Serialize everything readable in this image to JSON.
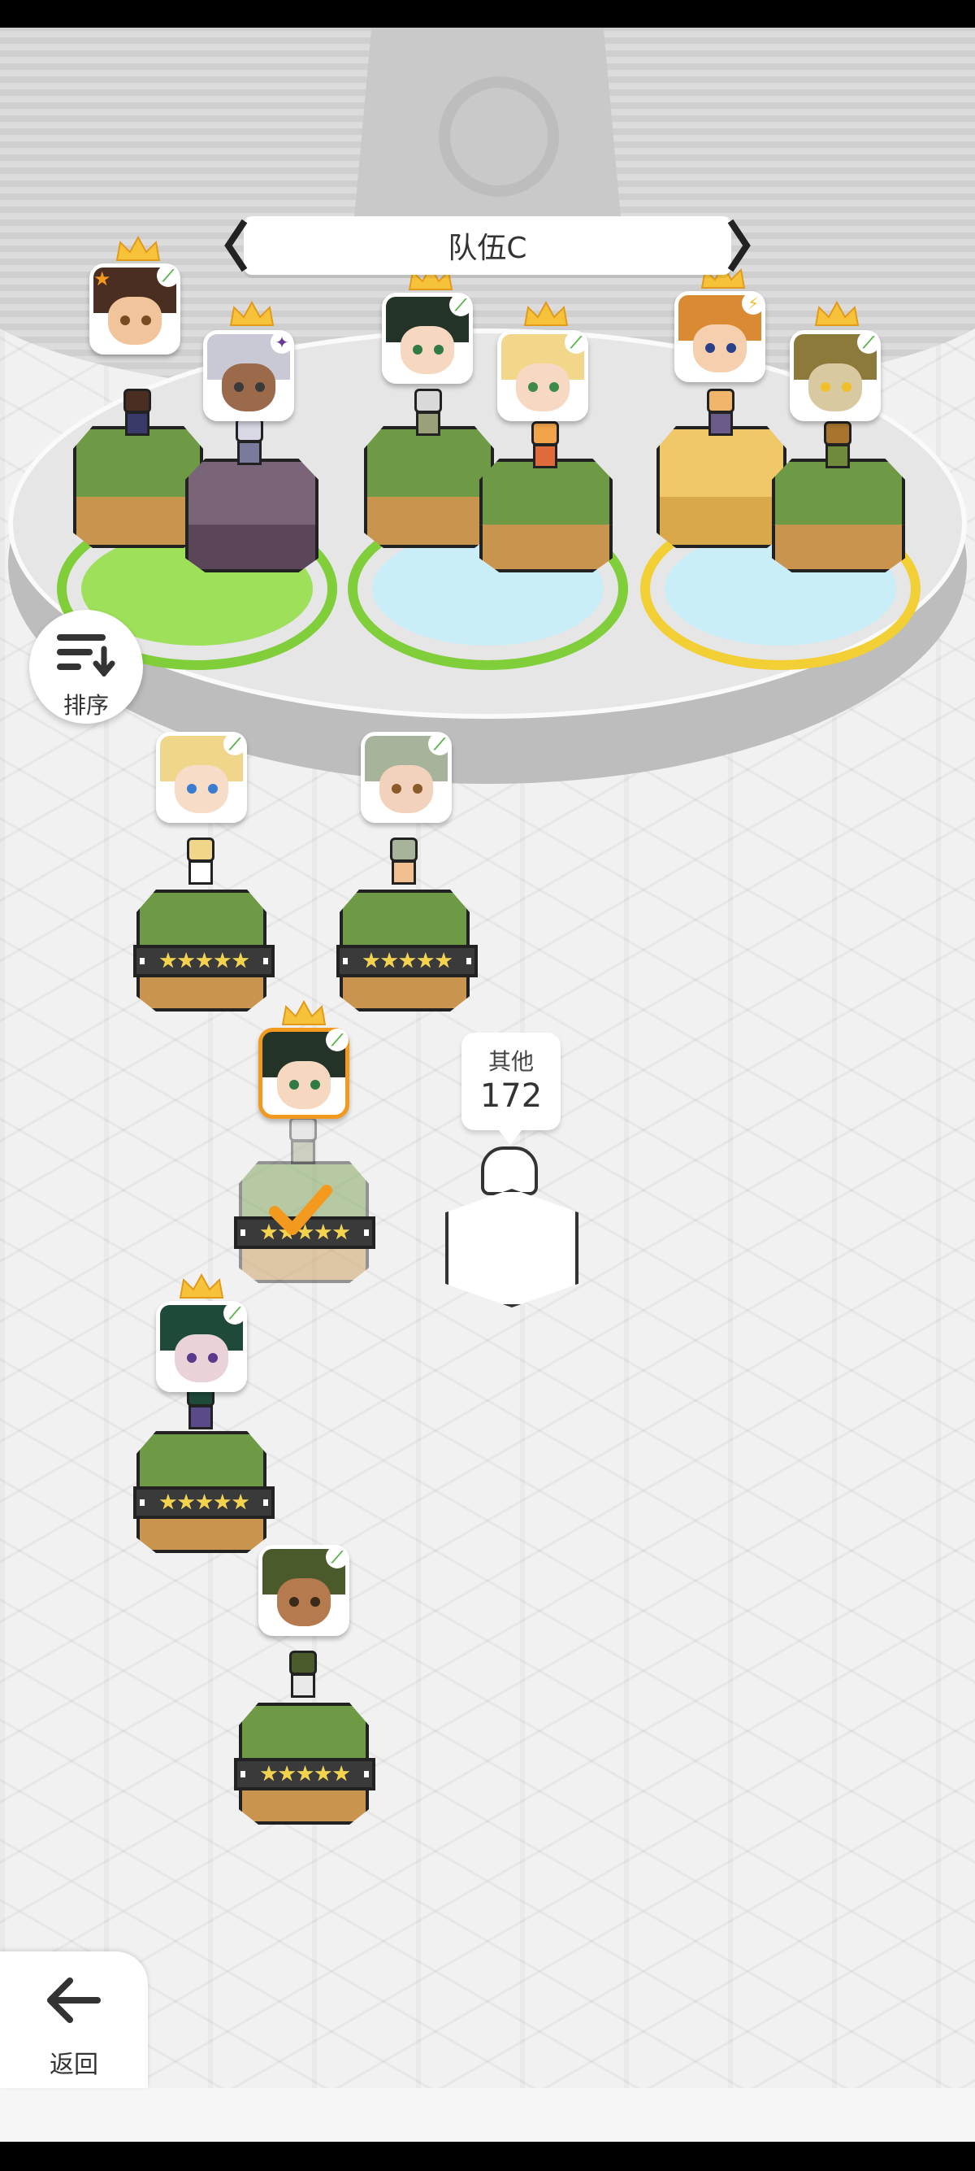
{
  "header": {
    "team_name": "队伍C"
  },
  "controls": {
    "sort_label": "排序",
    "back_label": "返回"
  },
  "others": {
    "label": "其他",
    "count": "172"
  },
  "team_slots": [
    {
      "hair": "#4a2e22",
      "skin": "#f2c49b",
      "eye": "#7a4a20",
      "element": "⟋",
      "crown": true,
      "badge": "★"
    },
    {
      "hair": "#c9c9d6",
      "skin": "#9b6a4a",
      "eye": "#3a3a3a",
      "element": "✦",
      "crown": true
    },
    {
      "hair": "#243327",
      "skin": "#f6d7bf",
      "eye": "#2f7a45",
      "element": "⟋",
      "crown": true
    },
    {
      "hair": "#f2d78a",
      "skin": "#f7d8c2",
      "eye": "#3d8a4a",
      "element": "⟋",
      "crown": true
    },
    {
      "hair": "#d98a32",
      "skin": "#f5cfae",
      "eye": "#2a3f8a",
      "element": "⚡",
      "crown": true
    },
    {
      "hair": "#8c7a3a",
      "skin": "#d9c9a0",
      "eye": "#f0c02a",
      "element": "⟋",
      "crown": true
    }
  ],
  "roster": [
    {
      "hair": "#f0d68a",
      "skin": "#f7dcc8",
      "eye": "#3b7bd0",
      "element": "⟋",
      "stars": "★★★★★"
    },
    {
      "hair": "#a7b39a",
      "skin": "#f2d2bc",
      "eye": "#8a5a2a",
      "element": "⟋",
      "stars": "★★★★★"
    },
    {
      "hair": "#243327",
      "skin": "#f6d7bf",
      "eye": "#2f7a45",
      "element": "⟋",
      "stars": "★★★★★",
      "selected": true,
      "crown": true
    },
    {
      "hair": "#1f4a3a",
      "skin": "#e9d3d8",
      "eye": "#5a3a8a",
      "element": "⟋",
      "stars": "★★★★★",
      "crown": true
    },
    {
      "hair": "#4a5a2a",
      "skin": "#b57a4e",
      "eye": "#3a2a1a",
      "element": "⟋",
      "stars": "★★★★★"
    }
  ],
  "colors": {
    "grass": "#6f9a45",
    "grass_dark": "#4e7a32",
    "dirt": "#c9954e",
    "stone": "#7a6478",
    "sand": "#f0c769",
    "ring_green": "#7fce3a",
    "ring_yellow": "#f1cf35",
    "ring_inner_blue": "#c9eef7",
    "selected_border": "#f39a1e"
  }
}
